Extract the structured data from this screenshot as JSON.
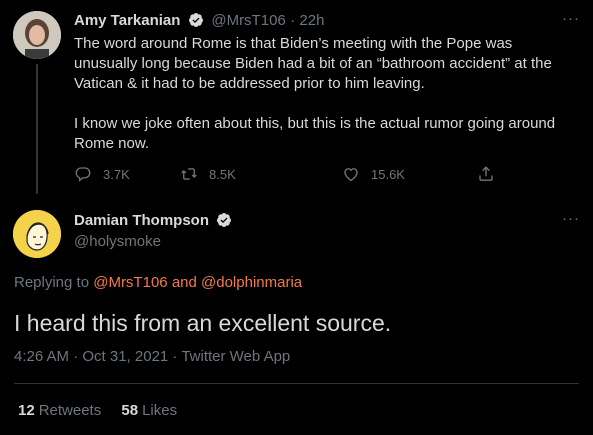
{
  "tweet1": {
    "name": "Amy Tarkanian",
    "handle": "@MrsT106",
    "time": "· 22h",
    "text_p1": "The word around Rome is that Biden’s meeting with the Pope was unusually long because Biden had a bit of an “bathroom accident” at the Vatican & it had to be addressed prior to him leaving.",
    "text_p2": "I know we joke often about this, but this is the actual rumor going around Rome now.",
    "reply_count": "3.7K",
    "retweet_count": "8.5K",
    "like_count": "15.6K",
    "more": "···"
  },
  "tweet2": {
    "name": "Damian Thompson",
    "handle": "@holysmoke",
    "replying_prefix": "Replying to",
    "replying_user1": "@MrsT106",
    "replying_and": "and",
    "replying_user2": "@dolphinmaria",
    "text": "I heard this from an excellent source.",
    "meta": "4:26 AM · Oct 31, 2021 · Twitter Web App",
    "retweets_num": "12",
    "retweets_label": "Retweets",
    "likes_num": "58",
    "likes_label": "Likes",
    "more": "···"
  },
  "colors": {
    "background": "#000000",
    "text": "#d9d9d9",
    "muted": "#6e767d",
    "link": "#f4794c",
    "divider": "#2f3336"
  },
  "icons": {
    "verified": "verified-badge-icon",
    "reply": "reply-icon",
    "retweet": "retweet-icon",
    "like": "heart-icon",
    "share": "share-icon"
  }
}
